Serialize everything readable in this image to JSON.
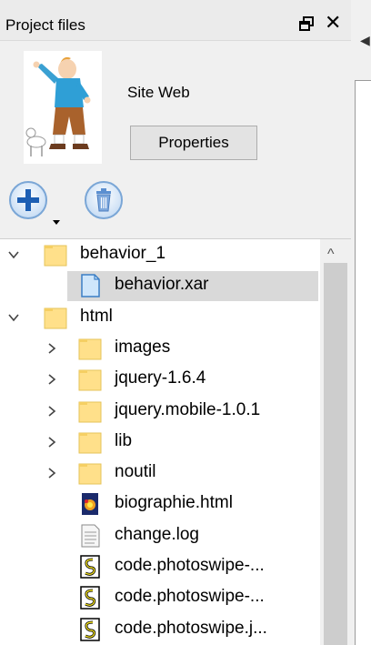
{
  "panel": {
    "title": "Project files",
    "close_glyph": "✕"
  },
  "header": {
    "site_name": "Site Web",
    "properties_label": "Properties"
  },
  "toolbar": {
    "add_icon": "add-icon",
    "delete_icon": "trash-icon"
  },
  "tree": {
    "nodes": [
      {
        "label": "behavior_1",
        "type": "folder",
        "depth": 0,
        "expander": "expanded"
      },
      {
        "label": "behavior.xar",
        "type": "file",
        "depth": 1,
        "selected": true
      },
      {
        "label": "html",
        "type": "folder",
        "depth": 0,
        "expander": "expanded"
      },
      {
        "label": "images",
        "type": "folder",
        "depth": 1,
        "expander": "collapsed"
      },
      {
        "label": "jquery-1.6.4",
        "type": "folder",
        "depth": 1,
        "expander": "collapsed"
      },
      {
        "label": "jquery.mobile-1.0.1",
        "type": "folder",
        "depth": 1,
        "expander": "collapsed"
      },
      {
        "label": "lib",
        "type": "folder",
        "depth": 1,
        "expander": "collapsed"
      },
      {
        "label": "noutil",
        "type": "folder",
        "depth": 1,
        "expander": "collapsed"
      },
      {
        "label": "biographie.html",
        "type": "html-file",
        "depth": 1
      },
      {
        "label": "change.log",
        "type": "text-file",
        "depth": 1
      },
      {
        "label": "code.photoswipe-...",
        "type": "script-file",
        "depth": 1
      },
      {
        "label": "code.photoswipe-...",
        "type": "script-file",
        "depth": 1
      },
      {
        "label": "code.photoswipe.j...",
        "type": "script-file",
        "depth": 1
      }
    ]
  }
}
